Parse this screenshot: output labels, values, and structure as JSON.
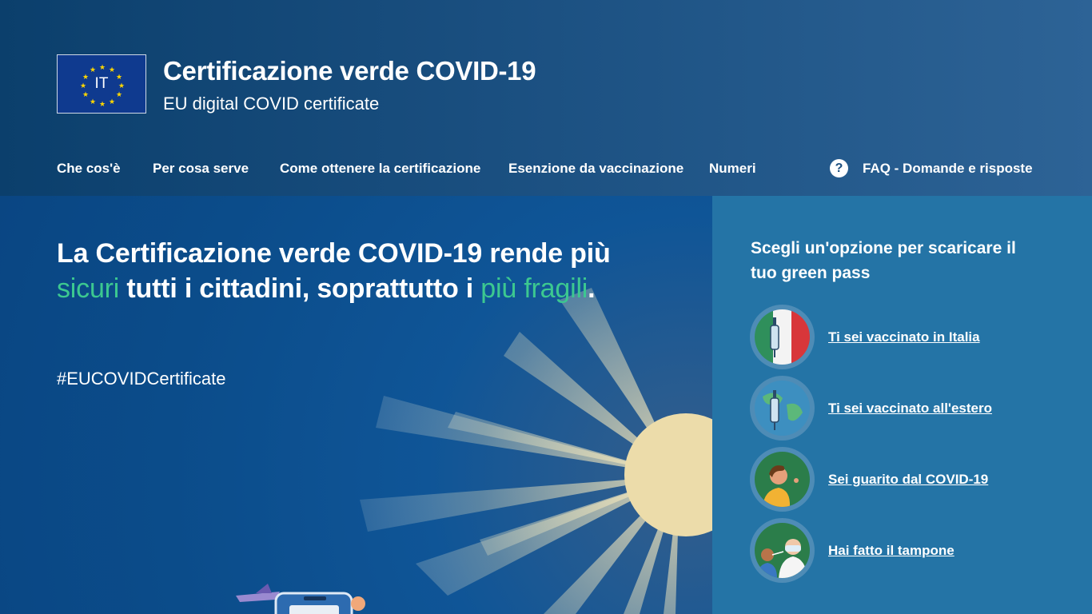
{
  "header": {
    "logo_text": "IT",
    "title": "Certificazione verde COVID-19",
    "subtitle": "EU digital COVID certificate"
  },
  "nav": {
    "items": [
      "Che cos'è",
      "Per cosa serve",
      "Come ottenere la certificazione",
      "Esenzione da vaccinazione",
      "Numeri"
    ],
    "faq_label": "FAQ - Domande e risposte",
    "faq_icon": "question-circle-icon"
  },
  "hero": {
    "headline_1": "La Certificazione verde COVID-19 rende più ",
    "headline_green_1": "sicuri",
    "headline_2": " tutti i cittadini, soprattutto i ",
    "headline_green_2": "più fragili",
    "headline_3": ".",
    "hashtag": "#EUCOVIDCertificate"
  },
  "panel": {
    "title": "Scegli un'opzione per scaricare il tuo green pass",
    "options": [
      {
        "label": "Ti sei vaccinato in Italia",
        "icon": "vaccine-italy-icon"
      },
      {
        "label": "Ti sei vaccinato all'estero",
        "icon": "vaccine-world-icon"
      },
      {
        "label": "Sei guarito dal COVID-19",
        "icon": "recovered-person-icon"
      },
      {
        "label": "Hai fatto il tampone",
        "icon": "swab-test-icon"
      }
    ]
  },
  "colors": {
    "accent_green": "#3cc890",
    "panel_bg": "#2474a6",
    "header_bg": "#0b3f6c"
  }
}
